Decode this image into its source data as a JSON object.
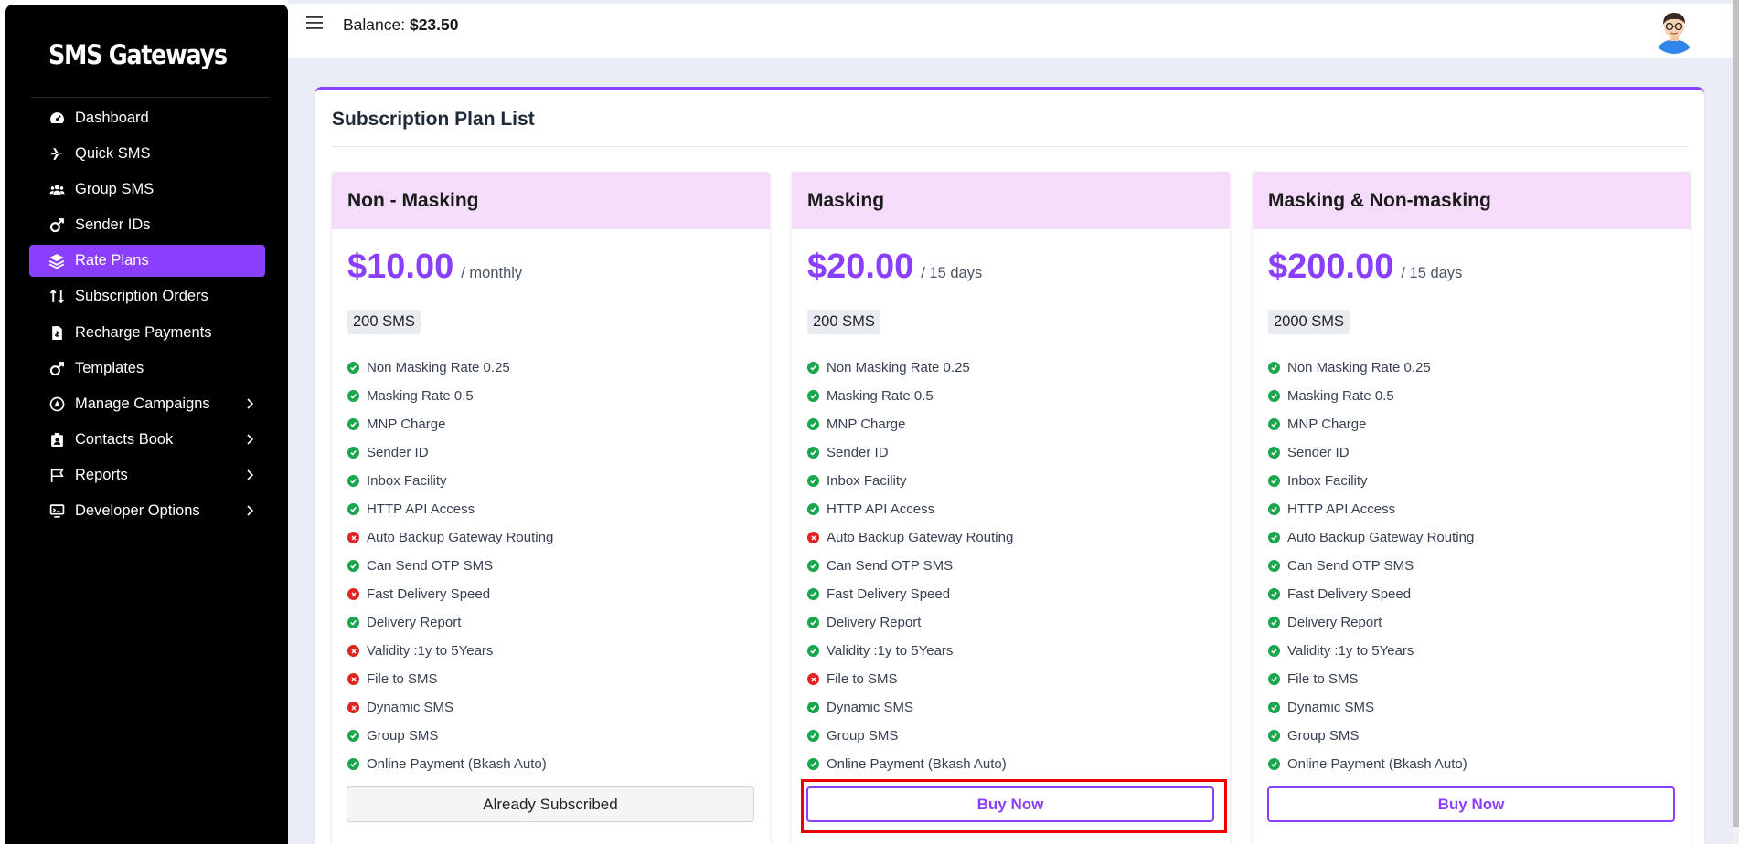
{
  "brand": "SMS Gateways",
  "nav": [
    {
      "label": "Dashboard",
      "icon": "speedometer-icon",
      "active": false
    },
    {
      "label": "Quick SMS",
      "icon": "plane-icon",
      "active": false
    },
    {
      "label": "Group SMS",
      "icon": "users-icon",
      "active": false
    },
    {
      "label": "Sender IDs",
      "icon": "male-symbol-icon",
      "active": false
    },
    {
      "label": "Rate Plans",
      "icon": "layers-icon",
      "active": true
    },
    {
      "label": "Subscription Orders",
      "icon": "sort-arrows-icon",
      "active": false
    },
    {
      "label": "Recharge Payments",
      "icon": "invoice-icon",
      "active": false
    },
    {
      "label": "Templates",
      "icon": "male-symbol-icon",
      "active": false
    },
    {
      "label": "Manage Campaigns",
      "icon": "campaign-icon",
      "active": false,
      "has_children": true
    },
    {
      "label": "Contacts Book",
      "icon": "contacts-icon",
      "active": false,
      "has_children": true
    },
    {
      "label": "Reports",
      "icon": "flag-icon",
      "active": false,
      "has_children": true
    },
    {
      "label": "Developer Options",
      "icon": "monitor-icon",
      "active": false,
      "has_children": true
    }
  ],
  "topbar": {
    "balance_label": "Balance: ",
    "balance_value": "$23.50"
  },
  "panel": {
    "title": "Subscription Plan List"
  },
  "plans": [
    {
      "name": "Non - Masking",
      "price": "$10.00",
      "period": "/ monthly",
      "sms": "200 SMS",
      "button": "Already Subscribed",
      "features": [
        {
          "label": "Non Masking Rate 0.25",
          "included": true
        },
        {
          "label": "Masking Rate 0.5",
          "included": true
        },
        {
          "label": "MNP Charge",
          "included": true
        },
        {
          "label": "Sender ID",
          "included": true
        },
        {
          "label": "Inbox Facility",
          "included": true
        },
        {
          "label": "HTTP API Access",
          "included": true
        },
        {
          "label": "Auto Backup Gateway Routing",
          "included": false
        },
        {
          "label": "Can Send OTP SMS",
          "included": true
        },
        {
          "label": "Fast Delivery Speed",
          "included": false
        },
        {
          "label": "Delivery Report",
          "included": true
        },
        {
          "label": "Validity :1y to 5Years",
          "included": false
        },
        {
          "label": "File to SMS",
          "included": false
        },
        {
          "label": "Dynamic SMS",
          "included": false
        },
        {
          "label": "Group SMS",
          "included": true
        },
        {
          "label": "Online Payment (Bkash Auto)",
          "included": true
        }
      ]
    },
    {
      "name": "Masking",
      "price": "$20.00",
      "period": "/ 15 days",
      "sms": "200 SMS",
      "button": "Buy Now",
      "features": [
        {
          "label": "Non Masking Rate 0.25",
          "included": true
        },
        {
          "label": "Masking Rate 0.5",
          "included": true
        },
        {
          "label": "MNP Charge",
          "included": true
        },
        {
          "label": "Sender ID",
          "included": true
        },
        {
          "label": "Inbox Facility",
          "included": true
        },
        {
          "label": "HTTP API Access",
          "included": true
        },
        {
          "label": "Auto Backup Gateway Routing",
          "included": false
        },
        {
          "label": "Can Send OTP SMS",
          "included": true
        },
        {
          "label": "Fast Delivery Speed",
          "included": true
        },
        {
          "label": "Delivery Report",
          "included": true
        },
        {
          "label": "Validity :1y to 5Years",
          "included": true
        },
        {
          "label": "File to SMS",
          "included": false
        },
        {
          "label": "Dynamic SMS",
          "included": true
        },
        {
          "label": "Group SMS",
          "included": true
        },
        {
          "label": "Online Payment (Bkash Auto)",
          "included": true
        }
      ]
    },
    {
      "name": "Masking & Non-masking",
      "price": "$200.00",
      "period": "/ 15 days",
      "sms": "2000 SMS",
      "button": "Buy Now",
      "features": [
        {
          "label": "Non Masking Rate 0.25",
          "included": true
        },
        {
          "label": "Masking Rate 0.5",
          "included": true
        },
        {
          "label": "MNP Charge",
          "included": true
        },
        {
          "label": "Sender ID",
          "included": true
        },
        {
          "label": "Inbox Facility",
          "included": true
        },
        {
          "label": "HTTP API Access",
          "included": true
        },
        {
          "label": "Auto Backup Gateway Routing",
          "included": true
        },
        {
          "label": "Can Send OTP SMS",
          "included": true
        },
        {
          "label": "Fast Delivery Speed",
          "included": true
        },
        {
          "label": "Delivery Report",
          "included": true
        },
        {
          "label": "Validity :1y to 5Years",
          "included": true
        },
        {
          "label": "File to SMS",
          "included": true
        },
        {
          "label": "Dynamic SMS",
          "included": true
        },
        {
          "label": "Group SMS",
          "included": true
        },
        {
          "label": "Online Payment (Bkash Auto)",
          "included": true
        }
      ]
    }
  ],
  "colors": {
    "accent": "#8a3ffc",
    "plan_header": "#f6dcfb",
    "included": "#19a64d",
    "excluded": "#e02424",
    "highlight": "#e00000"
  }
}
